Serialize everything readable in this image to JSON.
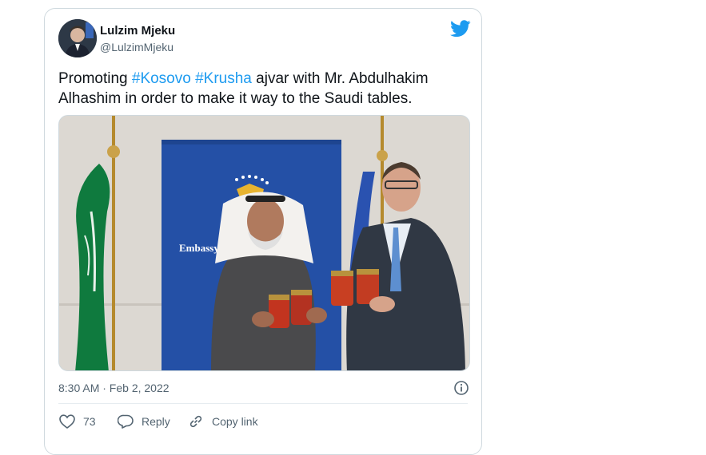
{
  "tweet": {
    "display_name": "Lulzim Mjeku",
    "handle": "@LulzimMjeku",
    "text_prefix": "Promoting ",
    "hashtag1": "#Kosovo",
    "space": " ",
    "hashtag2": "#Krusha",
    "text_suffix": " ajvar with Mr. Abdulhakim Alhashim in order to make it way to the Saudi tables.",
    "timestamp": "8:30 AM · Feb 2, 2022",
    "banner_text": "Embassy"
  },
  "actions": {
    "like_count": "73",
    "reply_label": "Reply",
    "copy_label": "Copy link"
  },
  "colors": {
    "accent": "#1d9bf0",
    "muted": "#536471"
  },
  "icons": [
    "twitter-bird-icon",
    "info-icon",
    "heart-icon",
    "reply-bubble-icon",
    "link-icon"
  ]
}
